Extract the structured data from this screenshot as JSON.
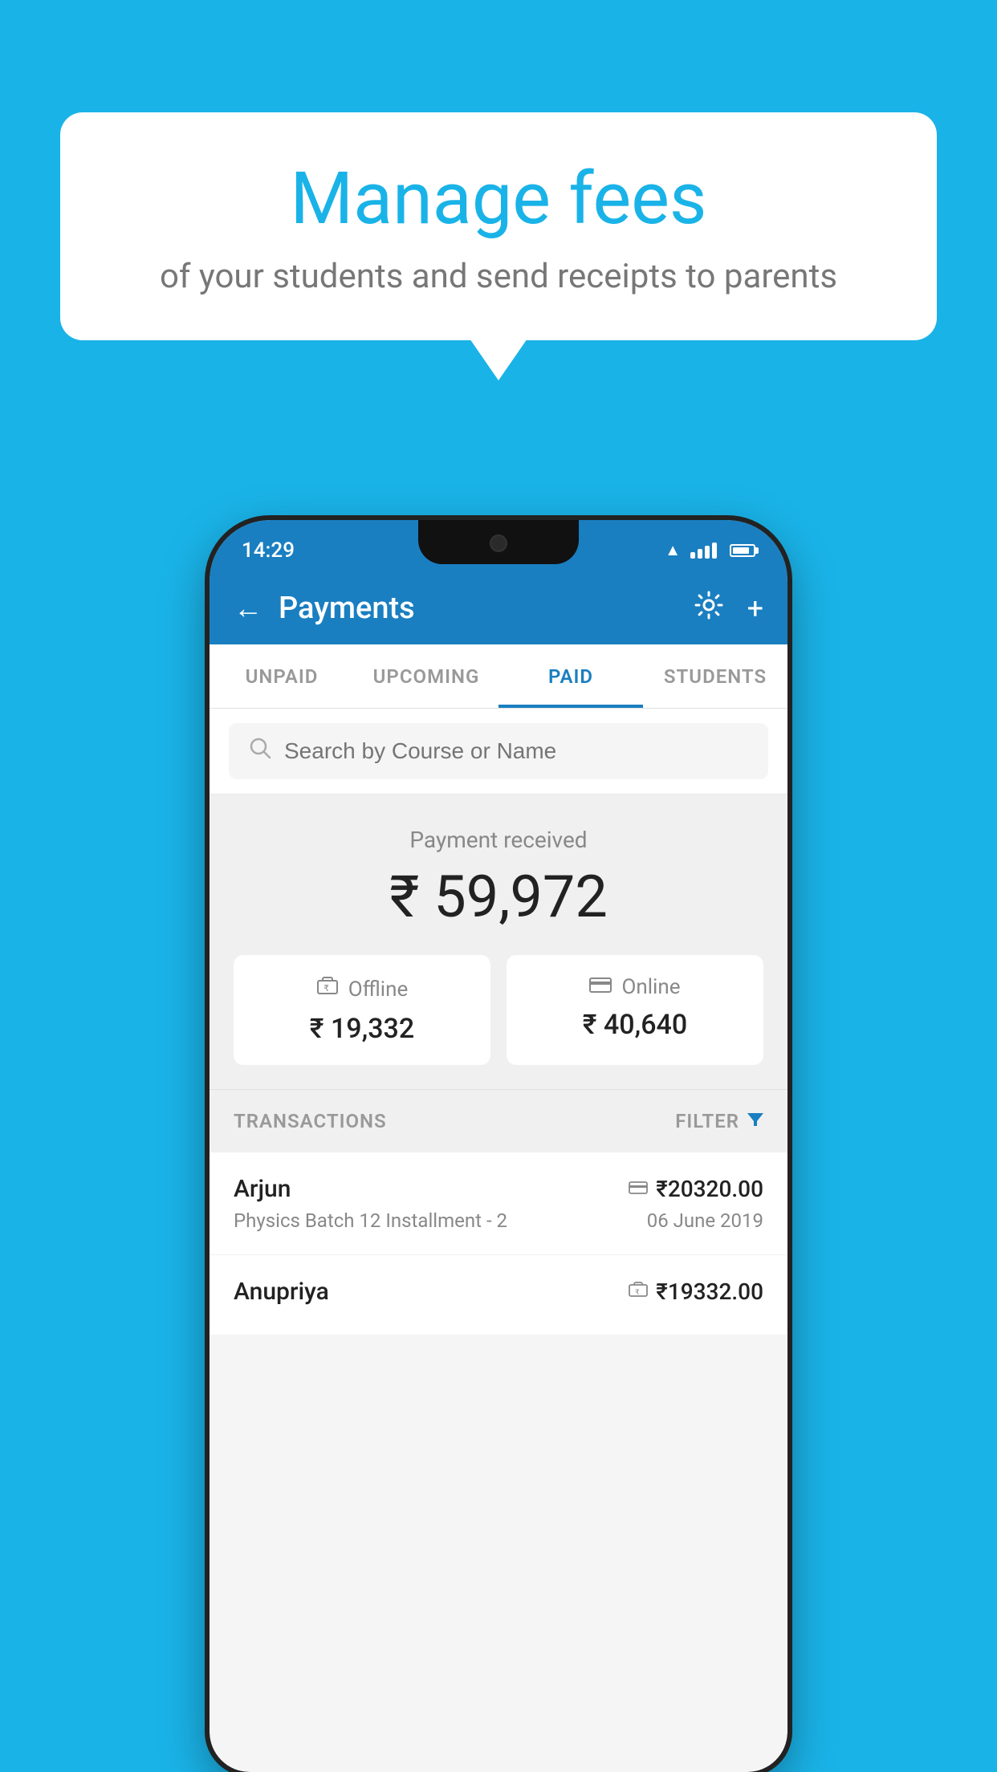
{
  "background_color": "#1ab3e8",
  "speech_bubble": {
    "title": "Manage fees",
    "subtitle": "of your students and send receipts to parents"
  },
  "status_bar": {
    "time": "14:29",
    "wifi": true,
    "signal": true,
    "battery": true
  },
  "app_header": {
    "title": "Payments",
    "back_label": "←",
    "settings_label": "⚙",
    "add_label": "+"
  },
  "tabs": [
    {
      "id": "unpaid",
      "label": "UNPAID",
      "active": false
    },
    {
      "id": "upcoming",
      "label": "UPCOMING",
      "active": false
    },
    {
      "id": "paid",
      "label": "PAID",
      "active": true
    },
    {
      "id": "students",
      "label": "STUDENTS",
      "active": false
    }
  ],
  "search": {
    "placeholder": "Search by Course or Name"
  },
  "payment_summary": {
    "received_label": "Payment received",
    "total_amount": "₹ 59,972",
    "offline_label": "Offline",
    "offline_amount": "₹ 19,332",
    "online_label": "Online",
    "online_amount": "₹ 40,640"
  },
  "transactions": {
    "header_label": "TRANSACTIONS",
    "filter_label": "FILTER",
    "items": [
      {
        "name": "Arjun",
        "amount": "₹20320.00",
        "type": "online",
        "details": "Physics Batch 12 Installment - 2",
        "date": "06 June 2019"
      },
      {
        "name": "Anupriya",
        "amount": "₹19332.00",
        "type": "offline",
        "details": "",
        "date": ""
      }
    ]
  }
}
